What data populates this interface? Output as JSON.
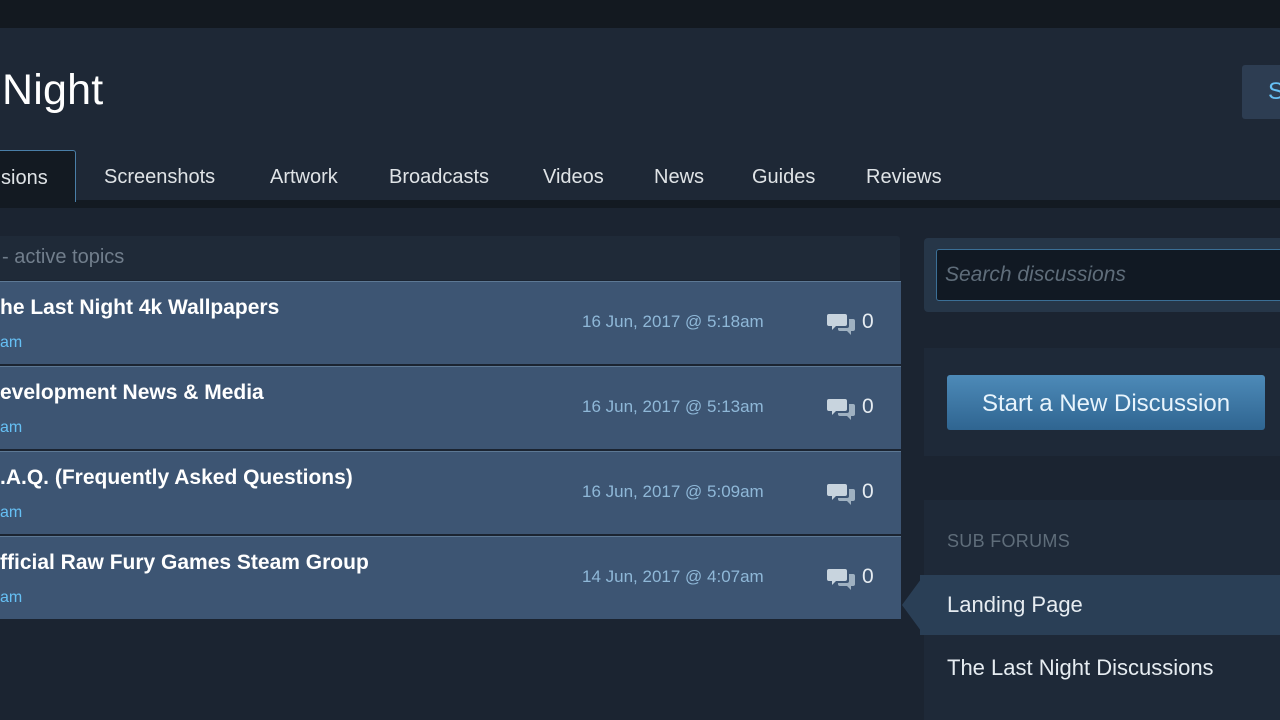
{
  "header": {
    "app_title": "Night",
    "top_right_button": "S"
  },
  "tabs": [
    {
      "label": "sions",
      "active": true
    },
    {
      "label": "Screenshots"
    },
    {
      "label": "Artwork"
    },
    {
      "label": "Broadcasts"
    },
    {
      "label": "Videos"
    },
    {
      "label": "News"
    },
    {
      "label": "Guides"
    },
    {
      "label": "Reviews"
    }
  ],
  "topics": {
    "header_label": "- active topics",
    "rows": [
      {
        "title": "he Last Night 4k Wallpapers",
        "author": "am",
        "date": "16 Jun, 2017 @ 5:18am",
        "replies": "0"
      },
      {
        "title": "evelopment News & Media",
        "author": "am",
        "date": "16 Jun, 2017 @ 5:13am",
        "replies": "0"
      },
      {
        "title": ".A.Q. (Frequently Asked Questions)",
        "author": "am",
        "date": "16 Jun, 2017 @ 5:09am",
        "replies": "0"
      },
      {
        "title": "fficial Raw Fury Games Steam Group",
        "author": "am",
        "date": "14 Jun, 2017 @ 4:07am",
        "replies": "0"
      }
    ]
  },
  "sidebar": {
    "search_placeholder": "Search discussions",
    "new_discussion_label": "Start a New Discussion",
    "subforums_label": "SUB FORUMS",
    "subforums": [
      {
        "label": "Landing Page",
        "active": true
      },
      {
        "label": "The Last Night Discussions"
      }
    ]
  },
  "icons": {
    "reply": "speech-bubbles-icon"
  },
  "colors": {
    "accent": "#66c0f4",
    "row_bg": "#3d5573",
    "button": "#3f7ba8"
  }
}
